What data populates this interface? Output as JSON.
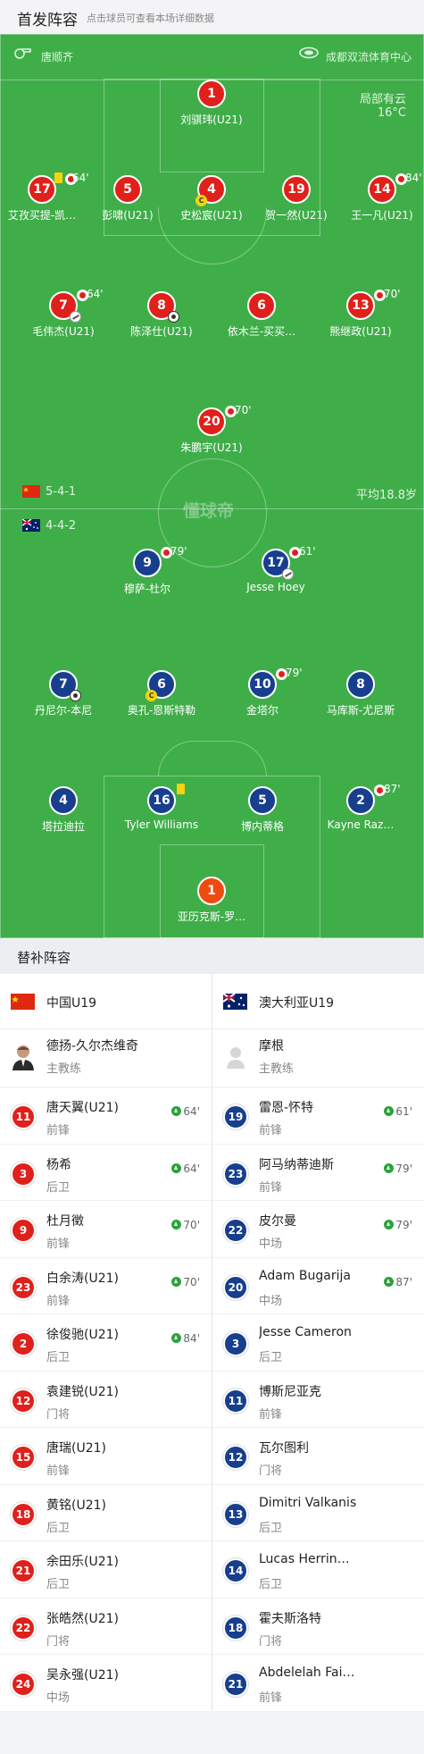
{
  "header": {
    "title": "首发阵容",
    "subtitle": "点击球员可查看本场详细数据"
  },
  "pitch": {
    "referee": "唐顺齐",
    "stadium": "成都双流体育中心",
    "weather": "局部有云",
    "temperature": "16°C",
    "watermark": "懂球帝",
    "home": {
      "formation": "5-4-1",
      "avg_age": "平均18.8岁"
    },
    "away": {
      "formation": "4-4-2"
    },
    "home_players": [
      {
        "num": "1",
        "name": "刘骐玮(U21)"
      },
      {
        "num": "17",
        "name": "艾孜买提-凯…",
        "sub": "64'"
      },
      {
        "num": "5",
        "name": "彭啸(U21)"
      },
      {
        "num": "4",
        "name": "史松宸(U21)"
      },
      {
        "num": "19",
        "name": "贺一然(U21)"
      },
      {
        "num": "14",
        "name": "王一凡(U21)",
        "sub": "84'"
      },
      {
        "num": "7",
        "name": "毛伟杰(U21)",
        "sub": "64'"
      },
      {
        "num": "8",
        "name": "陈泽仕(U21)"
      },
      {
        "num": "6",
        "name": "依木兰-买买…"
      },
      {
        "num": "13",
        "name": "熊继政(U21)",
        "sub": "70'"
      },
      {
        "num": "20",
        "name": "朱鹏宇(U21)",
        "sub": "70'"
      }
    ],
    "away_players": [
      {
        "num": "9",
        "name": "穆萨-杜尔",
        "sub": "79'"
      },
      {
        "num": "17",
        "name": "Jesse Hoey",
        "sub": "61'"
      },
      {
        "num": "7",
        "name": "丹尼尔-本尼"
      },
      {
        "num": "6",
        "name": "奥孔-恩斯特勒"
      },
      {
        "num": "10",
        "name": "金塔尔",
        "sub": "79'"
      },
      {
        "num": "8",
        "name": "马库斯-尤尼斯"
      },
      {
        "num": "4",
        "name": "塔拉迪拉"
      },
      {
        "num": "16",
        "name": "Tyler Williams"
      },
      {
        "num": "5",
        "name": "博内蒂格"
      },
      {
        "num": "2",
        "name": "Kayne Raz…",
        "sub": "87'"
      },
      {
        "num": "1",
        "name": "亚历克斯-罗…"
      }
    ]
  },
  "subs": {
    "title": "替补阵容",
    "home": {
      "team": "中国U19",
      "coach": {
        "name": "德扬-久尔杰维奇",
        "role": "主教练"
      },
      "players": [
        {
          "num": "11",
          "name": "唐天翼(U21)",
          "pos": "前锋",
          "in": "64'"
        },
        {
          "num": "3",
          "name": "杨希",
          "pos": "后卫",
          "in": "64'"
        },
        {
          "num": "9",
          "name": "杜月徵",
          "pos": "前锋",
          "in": "70'"
        },
        {
          "num": "23",
          "name": "白余涛(U21)",
          "pos": "前锋",
          "in": "70'"
        },
        {
          "num": "2",
          "name": "徐俊驰(U21)",
          "pos": "后卫",
          "in": "84'"
        },
        {
          "num": "12",
          "name": "袁建锐(U21)",
          "pos": "门将",
          "in": ""
        },
        {
          "num": "15",
          "name": "唐瑞(U21)",
          "pos": "前锋",
          "in": ""
        },
        {
          "num": "18",
          "name": "黄铭(U21)",
          "pos": "后卫",
          "in": ""
        },
        {
          "num": "21",
          "name": "余田乐(U21)",
          "pos": "后卫",
          "in": ""
        },
        {
          "num": "22",
          "name": "张皓然(U21)",
          "pos": "门将",
          "in": ""
        },
        {
          "num": "24",
          "name": "吴永强(U21)",
          "pos": "中场",
          "in": ""
        }
      ]
    },
    "away": {
      "team": "澳大利亚U19",
      "coach": {
        "name": "摩根",
        "role": "主教练"
      },
      "players": [
        {
          "num": "19",
          "name": "雷恩-怀特",
          "pos": "前锋",
          "in": "61'"
        },
        {
          "num": "23",
          "name": "阿马纳蒂迪斯",
          "pos": "前锋",
          "in": "79'"
        },
        {
          "num": "22",
          "name": "皮尔曼",
          "pos": "中场",
          "in": "79'"
        },
        {
          "num": "20",
          "name": "Adam Bugarija",
          "pos": "中场",
          "in": "87'"
        },
        {
          "num": "3",
          "name": "Jesse Cameron",
          "pos": "后卫",
          "in": ""
        },
        {
          "num": "11",
          "name": "博斯尼亚克",
          "pos": "前锋",
          "in": ""
        },
        {
          "num": "12",
          "name": "瓦尔图利",
          "pos": "门将",
          "in": ""
        },
        {
          "num": "13",
          "name": "Dimitri Valkanis",
          "pos": "后卫",
          "in": ""
        },
        {
          "num": "14",
          "name": "Lucas Herrin…",
          "pos": "后卫",
          "in": ""
        },
        {
          "num": "18",
          "name": "霍夫斯洛特",
          "pos": "门将",
          "in": ""
        },
        {
          "num": "21",
          "name": "Abdelelah Fai…",
          "pos": "前锋",
          "in": ""
        }
      ]
    }
  },
  "colors": {
    "pitch": "#3fae49",
    "home": "#e0201b",
    "away": "#173f8d",
    "sub_in": "#2aa33a"
  }
}
